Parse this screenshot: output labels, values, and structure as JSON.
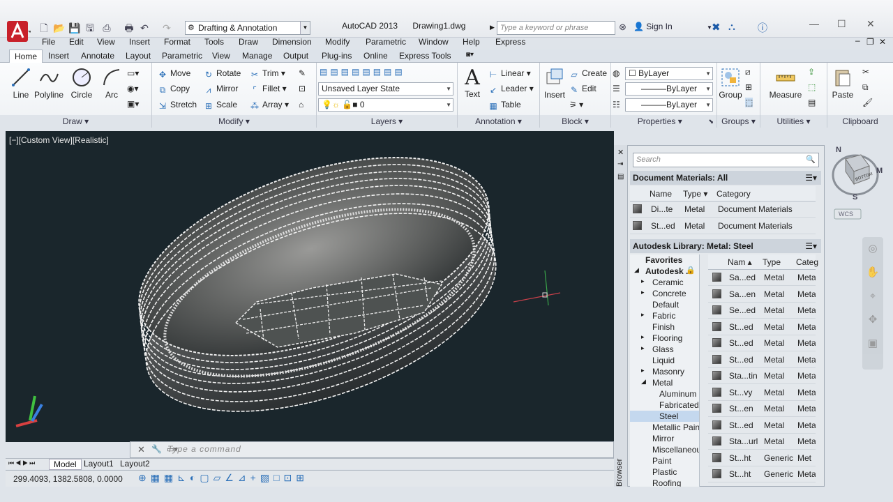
{
  "app": {
    "title": "AutoCAD 2013",
    "file": "Drawing1.dwg"
  },
  "workspace": "Drafting & Annotation",
  "search_placeholder": "Type a keyword or phrase",
  "sign_in": "Sign In",
  "menu": [
    "File",
    "Edit",
    "View",
    "Insert",
    "Format",
    "Tools",
    "Draw",
    "Dimension",
    "Modify",
    "Parametric",
    "Window",
    "Help",
    "Express"
  ],
  "tabs": [
    "Home",
    "Insert",
    "Annotate",
    "Layout",
    "Parametric",
    "View",
    "Manage",
    "Output",
    "Plug-ins",
    "Online",
    "Express Tools"
  ],
  "ribbon": {
    "draw": {
      "title": "Draw",
      "line": "Line",
      "polyline": "Polyline",
      "circle": "Circle",
      "arc": "Arc"
    },
    "modify": {
      "title": "Modify",
      "move": "Move",
      "rotate": "Rotate",
      "trim": "Trim",
      "copy": "Copy",
      "mirror": "Mirror",
      "fillet": "Fillet",
      "stretch": "Stretch",
      "scale": "Scale",
      "array": "Array"
    },
    "layers": {
      "title": "Layers",
      "state": "Unsaved Layer State",
      "layer": "0"
    },
    "annotation": {
      "title": "Annotation",
      "text": "Text",
      "linear": "Linear",
      "leader": "Leader",
      "table": "Table"
    },
    "block": {
      "title": "Block",
      "insert": "Insert",
      "create": "Create",
      "edit": "Edit"
    },
    "properties": {
      "title": "Properties",
      "color": "ByLayer",
      "linetype": "ByLayer",
      "lineweight": "ByLayer"
    },
    "groups": {
      "title": "Groups",
      "group": "Group"
    },
    "utilities": {
      "title": "Utilities",
      "measure": "Measure"
    },
    "clipboard": {
      "title": "Clipboard",
      "paste": "Paste"
    }
  },
  "viewport": {
    "label": "[−][Custom View][Realistic]"
  },
  "command": {
    "placeholder": "Type a command"
  },
  "layout_tabs": [
    "Model",
    "Layout1",
    "Layout2"
  ],
  "coords": "299.4093, 1382.5808, 0.0000",
  "viewcube": {
    "n": "N",
    "e": "M",
    "s": "S",
    "top": "BOTTOM",
    "wcs": "WCS"
  },
  "palette": {
    "search": "Search",
    "doc_header": "Document Materials: All",
    "doc_cols": [
      "Name",
      "Type",
      "Category"
    ],
    "doc_rows": [
      [
        "Di...te",
        "Metal",
        "Document Materials"
      ],
      [
        "St...ed",
        "Metal",
        "Document Materials"
      ]
    ],
    "lib_header": "Autodesk Library: Metal: Steel",
    "tree": [
      "Favorites",
      "Autodesk ...",
      "Ceramic",
      "Concrete",
      "Default",
      "Fabric",
      "Finish",
      "Flooring",
      "Glass",
      "Liquid",
      "Masonry",
      "Metal",
      "Aluminum",
      "Fabricated",
      "Steel",
      "Metallic Paint",
      "Mirror",
      "Miscellaneous",
      "Paint",
      "Plastic",
      "Roofing"
    ],
    "lib_cols": [
      "Nam",
      "Type",
      "Categ"
    ],
    "lib_rows": [
      [
        "Sa...ed",
        "Metal",
        "Meta"
      ],
      [
        "Sa...en",
        "Metal",
        "Meta"
      ],
      [
        "Se...ed",
        "Metal",
        "Meta"
      ],
      [
        "St...ed",
        "Metal",
        "Meta"
      ],
      [
        "St...ed",
        "Metal",
        "Meta"
      ],
      [
        "St...ed",
        "Metal",
        "Meta"
      ],
      [
        "Sta...tin",
        "Metal",
        "Meta"
      ],
      [
        "St...vy",
        "Metal",
        "Meta"
      ],
      [
        "St...en",
        "Metal",
        "Meta"
      ],
      [
        "St...ed",
        "Metal",
        "Meta"
      ],
      [
        "Sta...url",
        "Metal",
        "Meta"
      ],
      [
        "St...ht",
        "Generic",
        "Met"
      ],
      [
        "St...ht",
        "Generic",
        "Meta"
      ]
    ],
    "side_label": "Browser"
  }
}
